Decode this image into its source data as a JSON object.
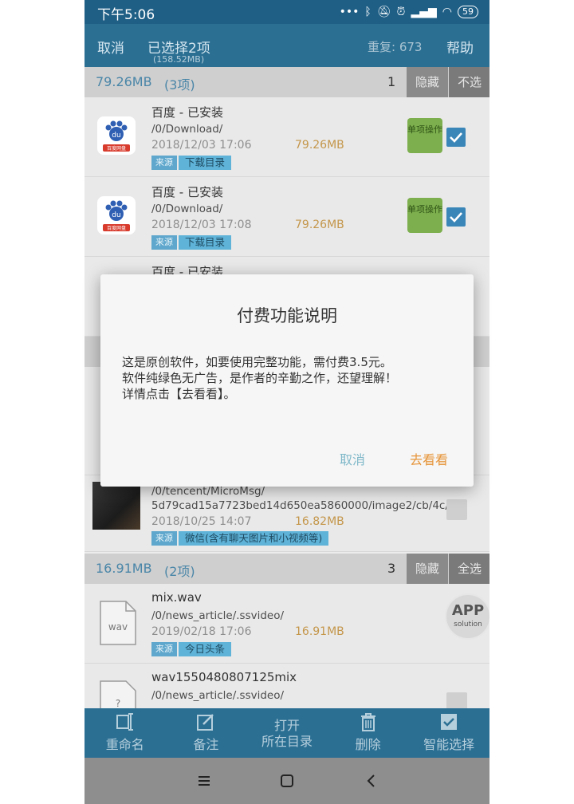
{
  "status": {
    "time": "下午5:06",
    "battery": "59"
  },
  "header": {
    "cancel": "取消",
    "selected": "已选择2项",
    "selected_size": "(158.52MB)",
    "duplicates": "重复: 673",
    "help": "帮助"
  },
  "groups": [
    {
      "size": "79.26MB",
      "count": "(3项)",
      "number": "1",
      "hide": "隐藏",
      "select": "不选"
    },
    {
      "size": "16.91MB",
      "count": "(2项)",
      "number": "3",
      "hide": "隐藏",
      "select": "全选"
    }
  ],
  "rows": [
    {
      "title": "百度 - 已安装",
      "path": "/0/Download/",
      "date": "2018/12/03 17:06",
      "size": "79.26MB",
      "src": "来源",
      "tag": "下载目录",
      "op": "单项操作"
    },
    {
      "title": "百度 - 已安装",
      "path": "/0/Download/",
      "date": "2018/12/03 17:08",
      "size": "79.26MB",
      "src": "来源",
      "tag": "下载目录",
      "op": "单项操作"
    },
    {
      "title": "百度 - 已安装"
    },
    {
      "path": "/0/tencent/MicroMsg/",
      "path2": "5d79cad15a7723bed14d650ea5860000/image2/cb/4c/",
      "date": "2018/10/25 14:07",
      "size": "16.82MB",
      "src": "来源",
      "tag": "微信(含有聊天图片和小视频等)"
    },
    {
      "title": "mix.wav",
      "path": "/0/news_article/.ssvideo/",
      "date": "2019/02/18 17:06",
      "size": "16.91MB",
      "src": "来源",
      "tag": "今日头条",
      "icon_label": "wav"
    },
    {
      "title": "wav1550480807125mix",
      "path": "/0/news_article/.ssvideo/"
    }
  ],
  "app_icon_label": "百度网盘",
  "badge": {
    "line1": "APP",
    "line2": "solution"
  },
  "toolbar": {
    "rename": "重命名",
    "note": "备注",
    "open_line1": "打开",
    "open_line2": "所在目录",
    "delete": "删除",
    "smart": "智能选择"
  },
  "dialog": {
    "title": "付费功能说明",
    "line1": "这是原创软件，如要使用完整功能，需付费3.5元。",
    "line2": "软件纯绿色无广告，是作者的辛勤之作，还望理解！",
    "line3": "详情点击【去看看】。",
    "cancel": "取消",
    "go": "去看看"
  },
  "colors": {
    "header_bg": "#2b6f93",
    "accent_orange": "#e6953a",
    "cancel_blue": "#7fb8c9"
  }
}
